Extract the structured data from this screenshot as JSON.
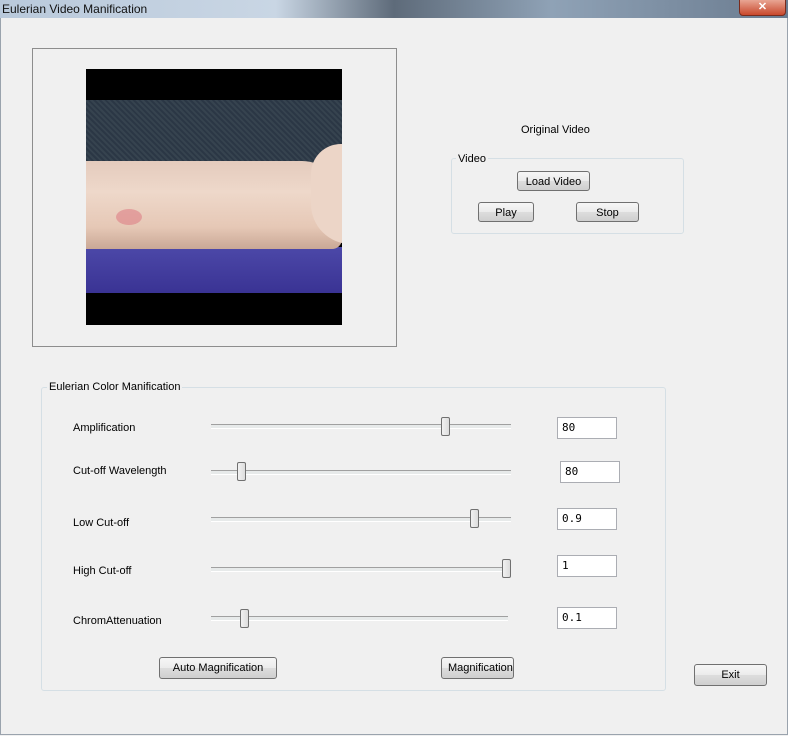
{
  "window": {
    "title": "Eulerian Video Manification",
    "close_glyph": "✕"
  },
  "video_panel": {
    "caption": "Original Video"
  },
  "video_group": {
    "legend": "Video",
    "load_label": "Load Video",
    "play_label": "Play",
    "stop_label": "Stop"
  },
  "manification": {
    "legend": "Eulerian Color Manification",
    "sliders": [
      {
        "label": "Amplification",
        "value": "80",
        "position": 0.79
      },
      {
        "label": "Cut-off Wavelength",
        "value": "80",
        "position": 0.09
      },
      {
        "label": "Low Cut-off",
        "value": "0.9",
        "position": 0.89
      },
      {
        "label": "High Cut-off",
        "value": "1",
        "position": 1.0
      },
      {
        "label": "ChromAttenuation",
        "value": "0.1",
        "position": 0.1
      }
    ],
    "auto_label": "Auto Magnification",
    "magnification_label": "Magnification"
  },
  "exit_label": "Exit"
}
